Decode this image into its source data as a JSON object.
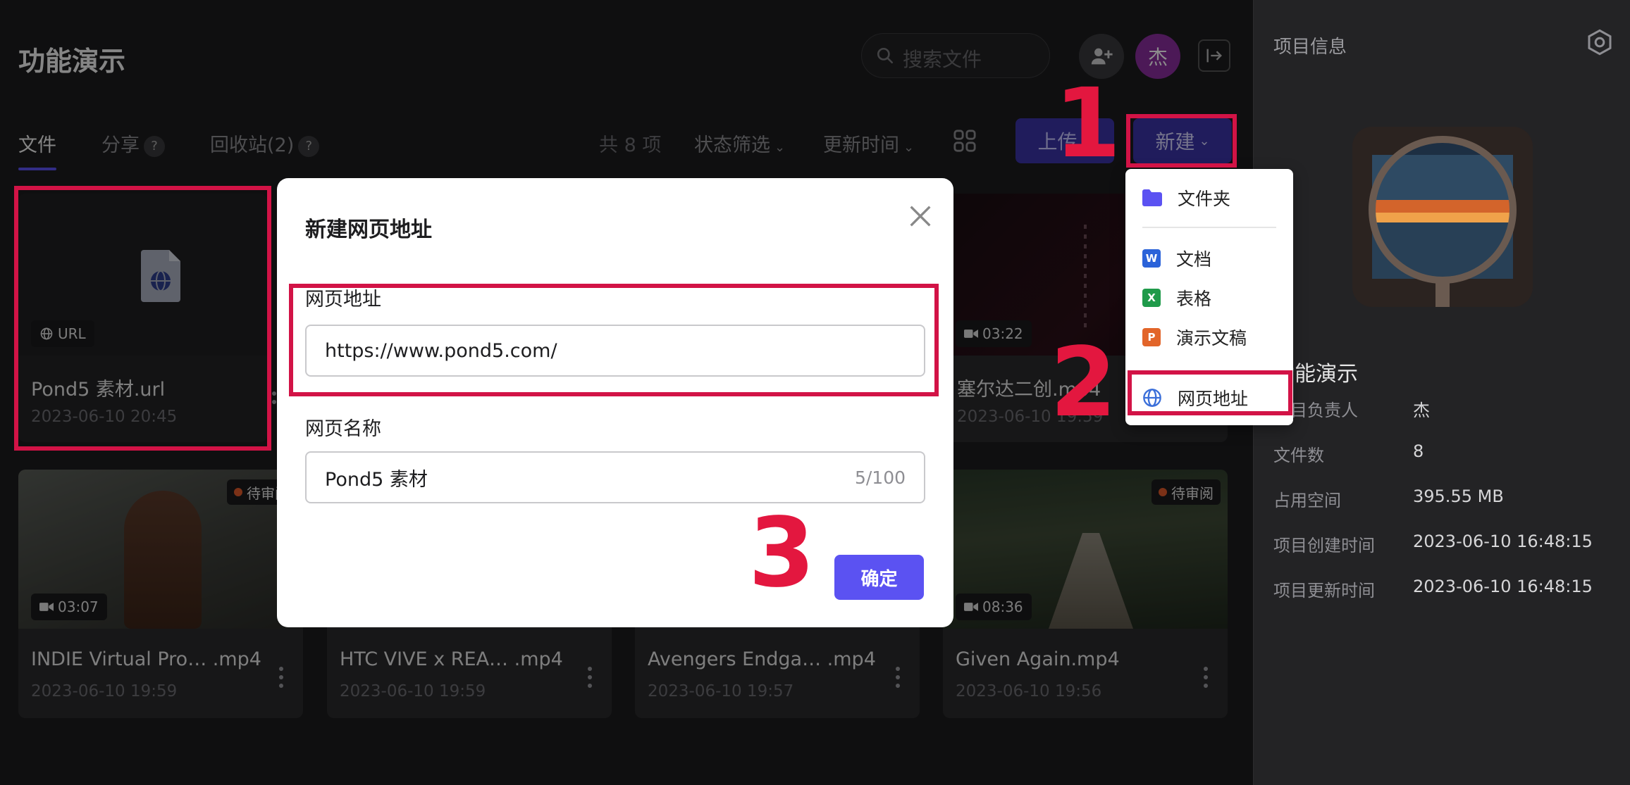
{
  "header": {
    "title": "功能演示",
    "search_placeholder": "搜索文件",
    "avatar_initial": "杰"
  },
  "tabs": [
    {
      "label": "文件"
    },
    {
      "label": "分享",
      "badge": "?"
    },
    {
      "label": "回收站(2)",
      "badge": "?"
    }
  ],
  "toolbar": {
    "count": "共 8 项",
    "status_filter": "状态筛选",
    "sort": "更新时间",
    "upload": "上传",
    "new": "新建"
  },
  "new_menu": {
    "items": [
      "文件夹",
      "文档",
      "表格",
      "演示文稿",
      "网页地址"
    ]
  },
  "files": [
    {
      "name": "Pond5 素材.url",
      "date": "2023-06-10 20:45",
      "badge": "URL"
    },
    {
      "name": "塞尔达二创.mp4",
      "date": "2023-06-10 19:59",
      "badge": "03:22"
    },
    {
      "name": "INDIE Virtual Pro… .mp4",
      "date": "2023-06-10 19:59",
      "badge": "03:07",
      "status": "待审阅"
    },
    {
      "name": "HTC VIVE x REA… .mp4",
      "date": "2023-06-10 19:59"
    },
    {
      "name": "Avengers Endga… .mp4",
      "date": "2023-06-10 19:57"
    },
    {
      "name": "Given Again.mp4",
      "date": "2023-06-10 19:56",
      "badge": "08:36",
      "status": "待审阅"
    }
  ],
  "modal": {
    "title": "新建网页地址",
    "url_label": "网页地址",
    "url_value": "https://www.pond5.com/",
    "name_label": "网页名称",
    "name_value": "Pond5 素材",
    "name_counter": "5/100",
    "confirm": "确定"
  },
  "callouts": [
    "1",
    "2",
    "3"
  ],
  "sidebar": {
    "title": "项目信息",
    "project_name": "功能演示",
    "info": [
      {
        "key": "项目负责人",
        "value": "杰"
      },
      {
        "key": "文件数",
        "value": "8"
      },
      {
        "key": "占用空间",
        "value": "395.55 MB"
      },
      {
        "key": "项目创建时间",
        "value": "2023-06-10 16:48:15"
      },
      {
        "key": "项目更新时间",
        "value": "2023-06-10 16:48:15"
      }
    ]
  },
  "colors": {
    "accent": "#5b52f2",
    "callout_red": "#e3173f",
    "background": "#1c1c1e"
  }
}
